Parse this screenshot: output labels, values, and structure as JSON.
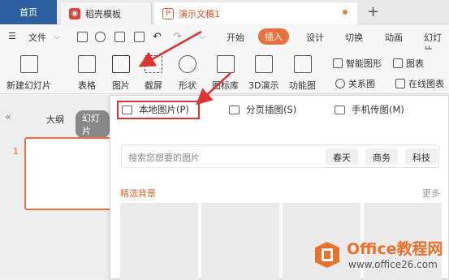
{
  "tabs": {
    "home": "首页",
    "template": "稻壳模板",
    "document": "演示文稿1"
  },
  "menu": {
    "file": "文件",
    "items": [
      "开始",
      "插入",
      "设计",
      "切换",
      "动画",
      "幻灯片"
    ],
    "active": "插入"
  },
  "ribbon": {
    "new_slide": "新建幻灯片",
    "table": "表格",
    "picture": "图片",
    "screenshot": "截屏",
    "shape": "形状",
    "icon_lib": "图标库",
    "three_d": "3D演示",
    "func_chart": "功能图",
    "smart_art": "智能图形",
    "chart": "图表",
    "relation": "关系图",
    "online_chart": "在线图表"
  },
  "left_pane": {
    "outline": "大纲",
    "slides": "幻灯片",
    "slide_number": "1"
  },
  "dropdown": {
    "local_picture": "本地图片(P)",
    "page_insert": "分页插图(S)",
    "phone_upload": "手机传图(M)",
    "search_placeholder": "搜索您想要的图片",
    "chips": [
      "春天",
      "商务",
      "科技"
    ],
    "section_title": "精选背景",
    "more": "更多"
  },
  "watermark": {
    "brand": "Office教程网",
    "url": "www.office26.com"
  },
  "colors": {
    "accent": "#e8723b",
    "highlight_red": "#dd3333",
    "home_tab": "#2c5f9e"
  }
}
